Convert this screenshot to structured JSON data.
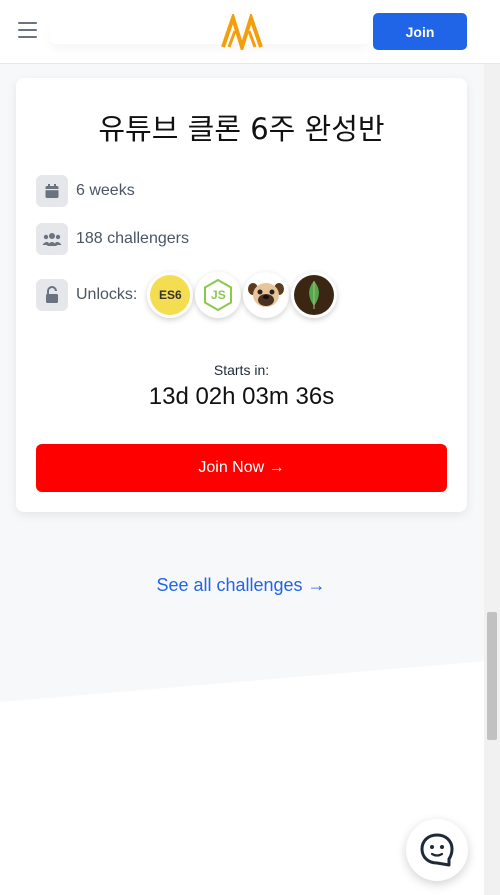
{
  "header": {
    "menu_icon": "hamburger-menu-icon",
    "logo_icon": "nomad-logo-icon",
    "join_label": "Join",
    "brand_color": "#2065e8",
    "logo_color": "#f59e0b"
  },
  "card": {
    "title": "유튜브 클론 6주 완성반",
    "duration": {
      "icon": "calendar-icon",
      "text": "6 weeks"
    },
    "challengers": {
      "icon": "users-icon",
      "text": "188 challengers"
    },
    "unlocks": {
      "icon": "unlock-icon",
      "label": "Unlocks:",
      "items": [
        {
          "name": "es6-icon",
          "text": "ES6"
        },
        {
          "name": "nodejs-icon",
          "text": "JS"
        },
        {
          "name": "pug-icon"
        },
        {
          "name": "mongodb-icon"
        }
      ]
    },
    "starts_label": "Starts in:",
    "countdown": "13d 02h 03m 36s",
    "cta_label": "Join Now →",
    "cta_color": "#ff0000"
  },
  "see_all_label": "See all challenges →",
  "chat": {
    "icon": "chat-bubble-icon"
  }
}
